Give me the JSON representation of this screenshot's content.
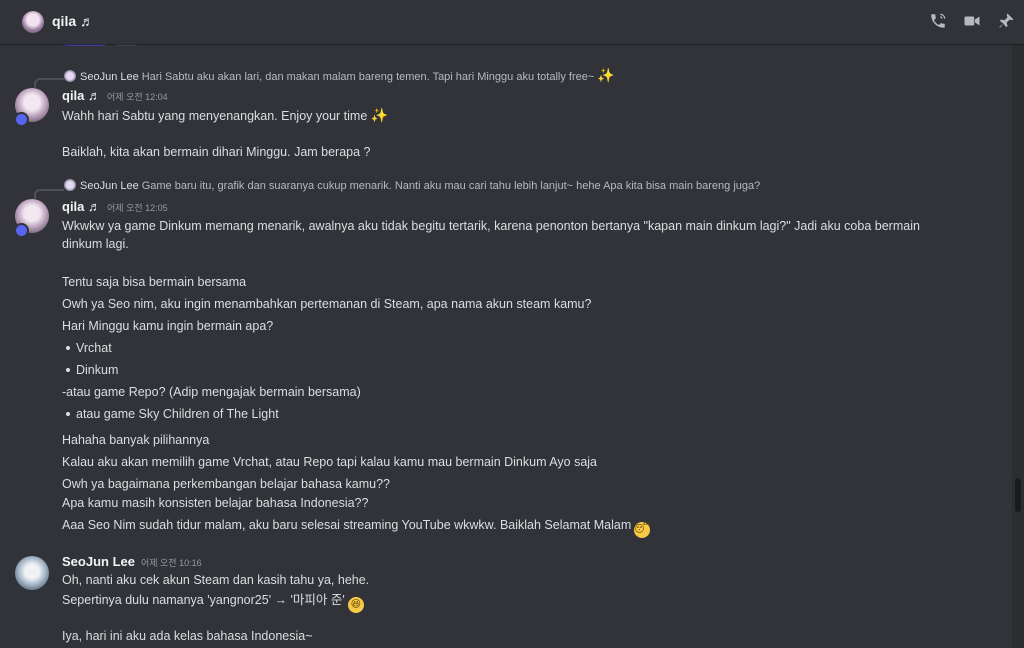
{
  "header": {
    "title": "qila ♬",
    "icons": [
      "phone-call-icon",
      "video-call-icon",
      "pin-icon"
    ]
  },
  "messages": [
    {
      "reply": {
        "name": "SeoJun Lee",
        "text": "Hari Sabtu aku akan lari, dan makan malam bareng temen. Tapi hari Minggu aku totally free~",
        "emoji": "✨"
      },
      "author": "qila ♬",
      "time": "어제 오전 12:04",
      "lines": [
        {
          "text": "Wahh hari Sabtu yang menyenangkan. Enjoy your time",
          "emoji": "✨"
        },
        {
          "text": "Baiklah, kita akan bermain dihari Minggu. Jam berapa ?"
        }
      ]
    },
    {
      "reply": {
        "name": "SeoJun Lee",
        "text": "Game baru itu, grafik dan suaranya cukup menarik. Nanti aku mau cari tahu lebih lanjut~ hehe Apa kita bisa main bareng juga?"
      },
      "author": "qila ♬",
      "time": "어제 오전 12:05",
      "lines": [
        {
          "text": "Wkwkw ya game Dinkum memang menarik, awalnya aku tidak begitu tertarik, karena penonton bertanya \"kapan main dinkum lagi?\" Jadi aku coba bermain"
        },
        {
          "text": "dinkum lagi."
        },
        {
          "text": "Tentu saja bisa bermain bersama"
        },
        {
          "text": "Owh ya Seo nim, aku ingin menambahkan pertemanan di Steam, apa nama akun steam kamu?"
        },
        {
          "text": "Hari Minggu kamu ingin bermain apa?"
        },
        {
          "text": "Vrchat",
          "bullet": true
        },
        {
          "text": "Dinkum",
          "bullet": true
        },
        {
          "text": "-atau game Repo? (Adip mengajak bermain bersama)"
        },
        {
          "text": "atau game Sky Children of The Light",
          "bullet": true
        },
        {
          "text": "Hahaha banyak pilihannya"
        },
        {
          "text": "Kalau aku akan memilih game Vrchat, atau Repo tapi kalau kamu mau bermain Dinkum Ayo saja"
        },
        {
          "text": "Owh ya bagaimana perkembangan belajar bahasa kamu??"
        },
        {
          "text": "Apa kamu masih konsisten belajar bahasa Indonesia??"
        },
        {
          "text": "Aaa Seo Nim sudah tidur malam, aku baru selesai streaming YouTube wkwkw. Baiklah Selamat Malam",
          "face": "😴"
        }
      ]
    },
    {
      "author": "SeoJun Lee",
      "time": "어제 오전 10:16",
      "lines": [
        {
          "text": "Oh, nanti aku cek akun Steam dan kasih tahu ya, hehe."
        },
        {
          "text": "Sepertinya dulu namanya 'yangnor25' → '마피아 준'",
          "face": "😆"
        },
        {
          "text": "Iya, hari ini aku ada kelas bahasa Indonesia~"
        }
      ]
    }
  ]
}
